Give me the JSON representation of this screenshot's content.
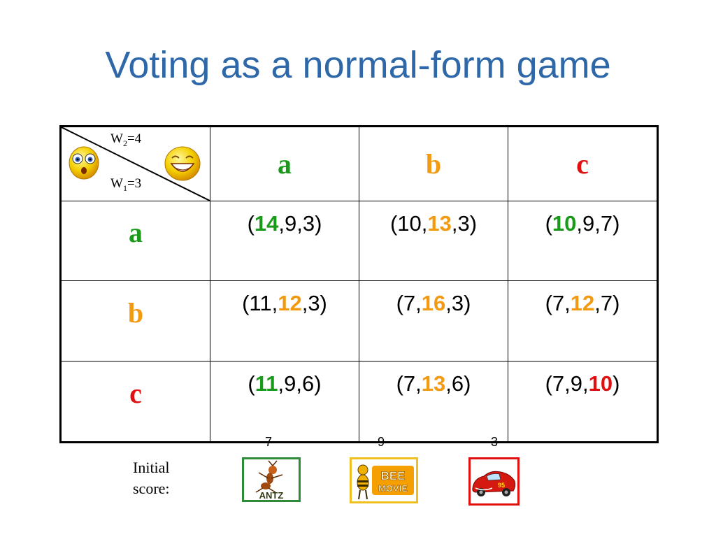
{
  "title": "Voting as a normal-form game",
  "corner": {
    "w2_prefix": "W",
    "w2_sub": "2",
    "w2_suffix": "=4",
    "w1_prefix": "W",
    "w1_sub": "1",
    "w1_suffix": "=3"
  },
  "columns": [
    {
      "label": "a",
      "color": "#1a9a1a"
    },
    {
      "label": "b",
      "color": "#f29a12"
    },
    {
      "label": "c",
      "color": "#e01010"
    }
  ],
  "rows": [
    {
      "label": "a",
      "color": "#1a9a1a",
      "cells": [
        {
          "p": "(",
          "v1": "14",
          "v2": ",9,3)",
          "pre": "",
          "hl": "green"
        },
        {
          "p": "(10,",
          "v1": "13",
          "v2": ",3)",
          "hl": "orange"
        },
        {
          "p": "(",
          "v1": "10",
          "v2": ",9,7)",
          "hl": "green"
        }
      ]
    },
    {
      "label": "b",
      "color": "#f29a12",
      "cells": [
        {
          "p": "(11,",
          "v1": "12",
          "v2": ",3)",
          "hl": "orange"
        },
        {
          "p": "(7,",
          "v1": "16",
          "v2": ",3)",
          "hl": "orange"
        },
        {
          "p": "(7,",
          "v1": "12",
          "v2": ",7)",
          "hl": "orange"
        }
      ]
    },
    {
      "label": "c",
      "color": "#e01010",
      "cells": [
        {
          "p": "(",
          "v1": "11",
          "v2": ",9,6)",
          "hl": "green"
        },
        {
          "p": "(7,",
          "v1": "13",
          "v2": ",6)",
          "hl": "orange"
        },
        {
          "p": "(7,9,",
          "v1": "10",
          "v2": ")",
          "hl": "red"
        }
      ]
    }
  ],
  "initial_score": {
    "label_line1": "Initial",
    "label_line2": "score:",
    "movies": [
      {
        "name": "ANTZ",
        "score": "7",
        "border": "#2e8b3a"
      },
      {
        "name": "BEE MOVIE",
        "score": "9",
        "border": "#f0c020"
      },
      {
        "name": "CARS",
        "score": "3",
        "border": "#e01010"
      }
    ]
  }
}
